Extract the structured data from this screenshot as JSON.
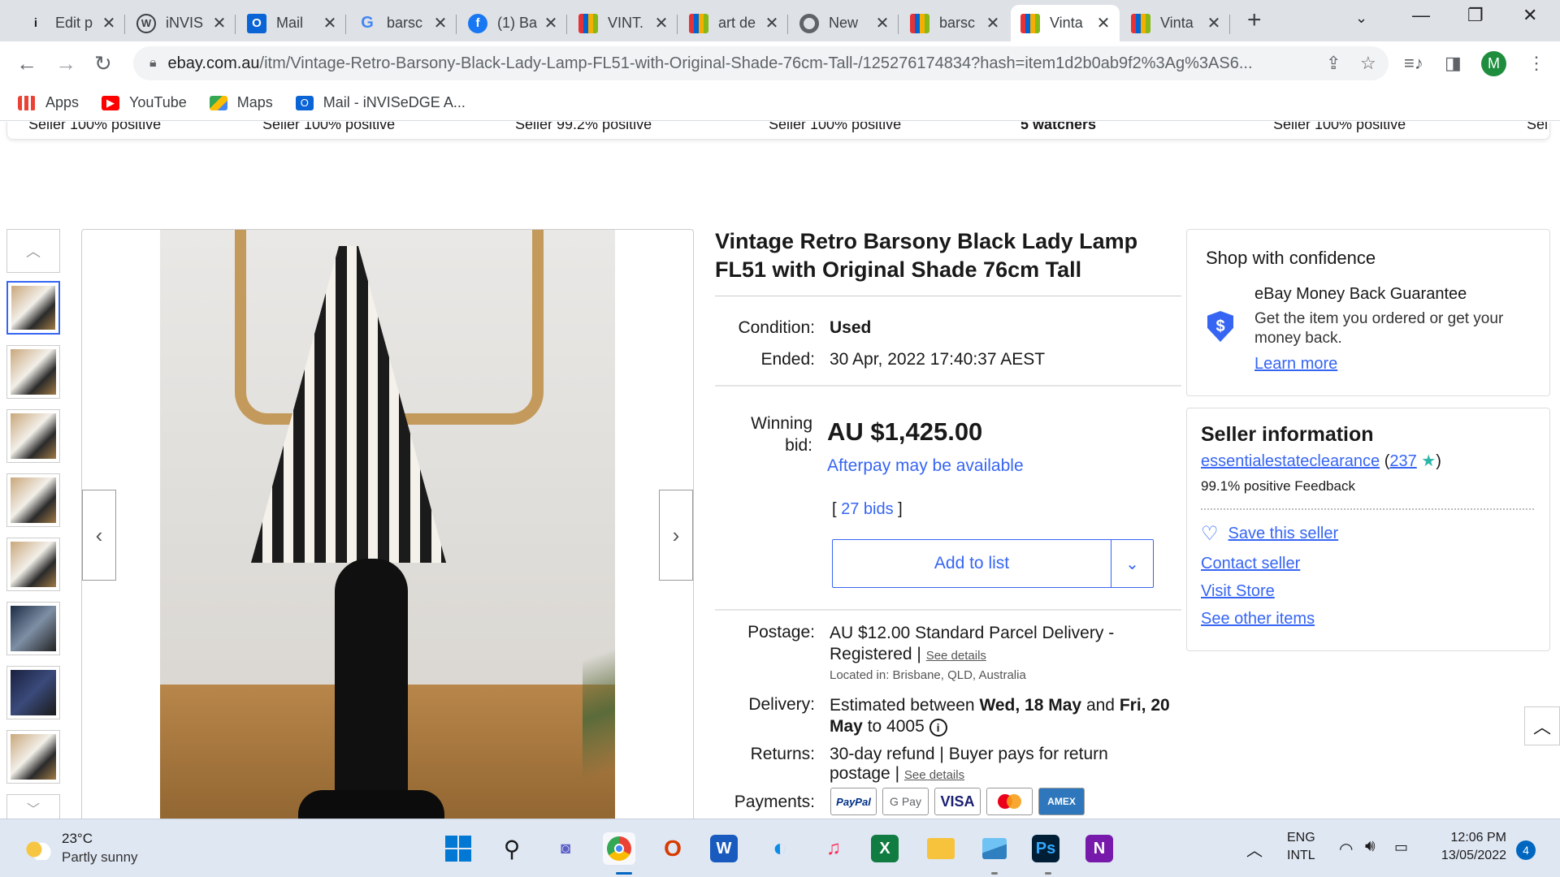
{
  "browser": {
    "tabs": [
      {
        "label": "Edit p",
        "icon": "info-icon"
      },
      {
        "label": "iNVIS",
        "icon": "wordpress-icon"
      },
      {
        "label": "Mail",
        "icon": "outlook-icon"
      },
      {
        "label": "barsc",
        "icon": "google-icon"
      },
      {
        "label": "(1) Ba",
        "icon": "facebook-icon"
      },
      {
        "label": "VINT.",
        "icon": "ebay-bag-icon"
      },
      {
        "label": "art de",
        "icon": "ebay-bag-icon"
      },
      {
        "label": "New",
        "icon": "chrome-icon"
      },
      {
        "label": "barsc",
        "icon": "ebay-bag-icon"
      },
      {
        "label": "Vinta",
        "icon": "ebay-bag-icon"
      },
      {
        "label": "Vinta",
        "icon": "ebay-bag-icon"
      }
    ],
    "url_host": "ebay.com.au",
    "url_path": "/itm/Vintage-Retro-Barsony-Black-Lady-Lamp-FL51-with-Original-Shade-76cm-Tall-/125276174834?hash=item1d2b0ab9f2%3Ag%3AS6...",
    "profile_initial": "M",
    "bookmarks": [
      {
        "label": "Apps",
        "icon": "apps-grid-icon"
      },
      {
        "label": "YouTube",
        "icon": "youtube-icon"
      },
      {
        "label": "Maps",
        "icon": "maps-icon"
      },
      {
        "label": "Mail - iNVISeDGE A...",
        "icon": "outlook-icon"
      }
    ]
  },
  "carousel_strip": [
    "Seller 100% positive",
    "Seller 100% positive",
    "Seller 99.2% positive",
    "Seller 100% positive",
    "5 watchers",
    "Seller 100% positive",
    "Sel"
  ],
  "item": {
    "title": "Vintage Retro Barsony Black Lady Lamp FL51 with Original Shade 76cm Tall",
    "condition_label": "Condition:",
    "condition": "Used",
    "ended_label": "Ended:",
    "ended": "30 Apr, 2022  17:40:37 AEST",
    "winning_bid_label": "Winning bid:",
    "price": "AU $1,425.00",
    "afterpay": "Afterpay may be available",
    "bids_open": "[ ",
    "bids": "27 bids",
    "bids_close": " ]",
    "add_to_list": "Add to list",
    "postage_label": "Postage:",
    "postage_price": "AU $12.00",
    "postage_service": " Standard Parcel Delivery - Registered | ",
    "see_details": "See details",
    "located": "Located in: Brisbane, QLD, Australia",
    "delivery_label": "Delivery:",
    "delivery_prefix": "Estimated between ",
    "delivery_start": "Wed, 18 May",
    "delivery_and": " and ",
    "delivery_end": "Fri, 20 May",
    "delivery_suffix": " to 4005",
    "returns_label": "Returns:",
    "returns": "30-day refund | Buyer pays for return postage | ",
    "payments_label": "Payments:",
    "payment_methods": [
      "PayPal",
      "G Pay",
      "VISA",
      "Mastercard",
      "AMEX"
    ]
  },
  "confidence": {
    "heading": "Shop with confidence",
    "guarantee_title": "eBay Money Back Guarantee",
    "guarantee_text": "Get the item you ordered or get your money back.",
    "learn_more": "Learn more"
  },
  "seller": {
    "heading": "Seller information",
    "name": "essentialestateclearance",
    "feedback_open": " (",
    "feedback_count": "237",
    "feedback_close": ")",
    "positive": "99.1% positive Feedback",
    "save": "Save this seller",
    "contact": "Contact seller",
    "visit": "Visit Store",
    "other": "See other items"
  },
  "taskbar": {
    "temperature": "23°C",
    "weather": "Partly sunny",
    "lang1": "ENG",
    "lang2": "INTL",
    "time": "12:06 PM",
    "date": "13/05/2022",
    "notifications": "4"
  },
  "colors": {
    "ebay_blue": "#3665f3",
    "chrome_tabstrip": "#dee1e6",
    "taskbar": "#dfe7f3"
  }
}
